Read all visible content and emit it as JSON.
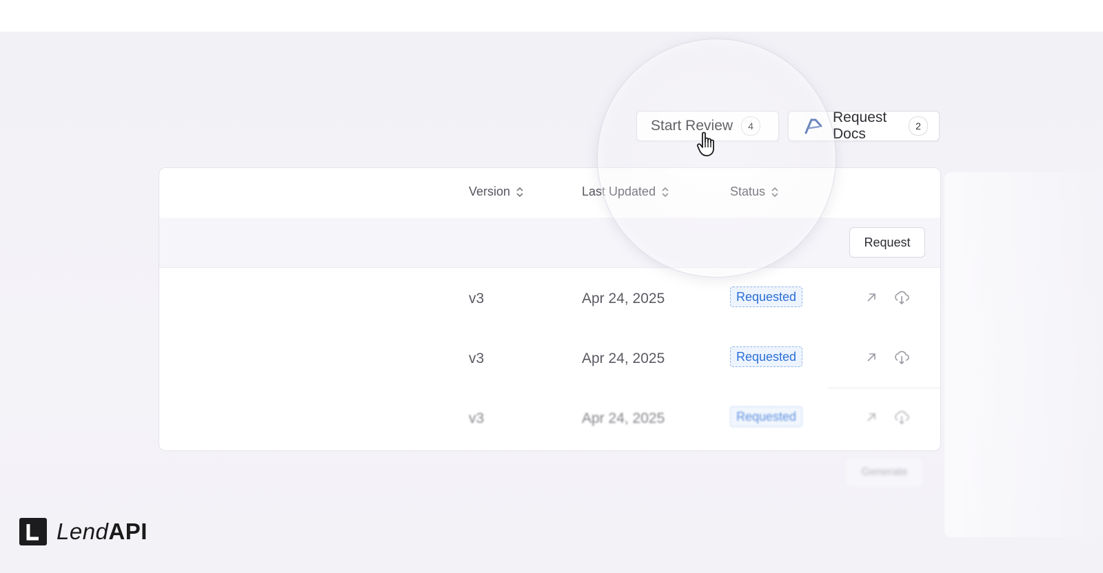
{
  "toolbar": {
    "start_review": {
      "label": "Start Review",
      "count": "4"
    },
    "request_docs": {
      "label": "Request Docs",
      "count": "2"
    }
  },
  "table": {
    "columns": [
      "Version",
      "Last Updated",
      "Status"
    ],
    "filter_row": {
      "request_label": "Request"
    },
    "rows": [
      {
        "version": "v3",
        "last_updated": "Apr 24, 2025",
        "status": "Requested"
      },
      {
        "version": "v3",
        "last_updated": "Apr 24, 2025",
        "status": "Requested"
      },
      {
        "version": "v3",
        "last_updated": "Apr 24, 2025",
        "status": "Requested"
      }
    ],
    "row_icons": [
      "open-external-icon",
      "cloud-download-icon"
    ]
  },
  "generate_label": "Generate",
  "brand": {
    "part1": "Lend",
    "part2": "API"
  },
  "colors": {
    "status_blue": "#2b6fd6",
    "status_bg": "#eef4fd",
    "background": "#f2f1f6"
  }
}
